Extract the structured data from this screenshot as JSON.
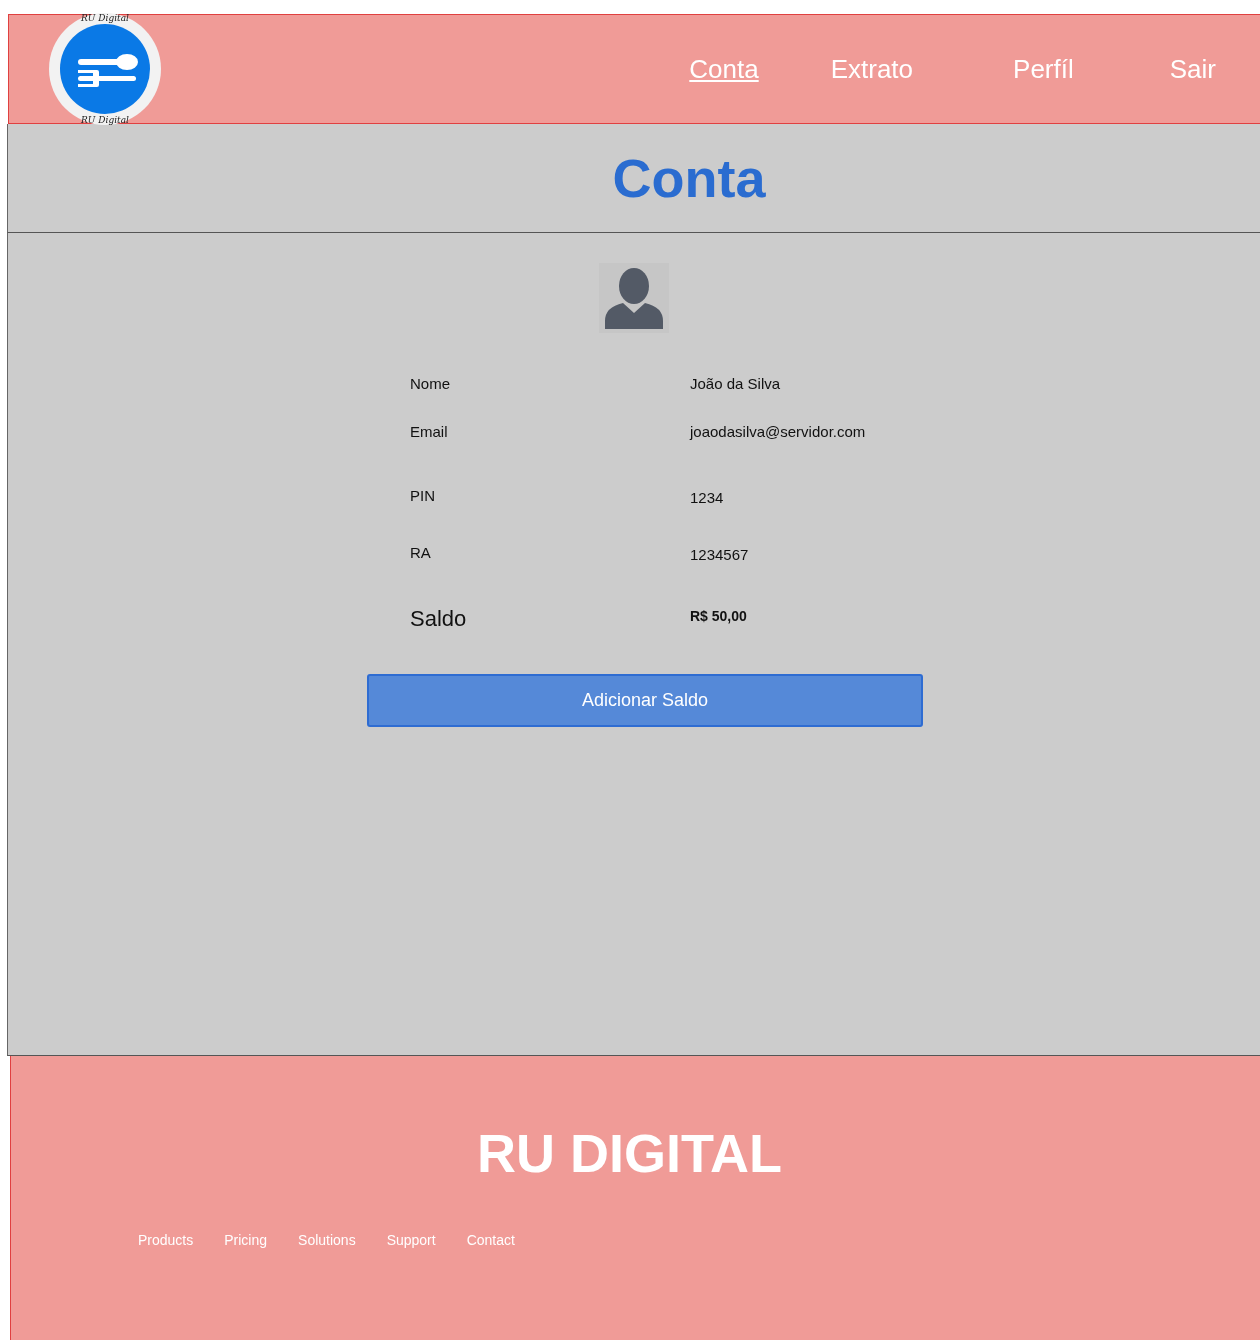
{
  "header": {
    "logo": {
      "top_text": "RU Digital",
      "bottom_text": "RU Digital"
    },
    "nav": [
      {
        "label": "Conta",
        "selected": true
      },
      {
        "label": "Extrato",
        "selected": false
      },
      {
        "label": "Perfíl",
        "selected": false
      },
      {
        "label": "Sair",
        "selected": false
      }
    ]
  },
  "page_title": "Conta",
  "fields": [
    {
      "label": "Nome",
      "value": "João da Silva",
      "kind": "plain"
    },
    {
      "label": "Email",
      "value": "joaodasilva@servidor.com",
      "kind": "plain"
    },
    {
      "label": "PIN",
      "value": "1234",
      "kind": "plain"
    },
    {
      "label": "RA",
      "value": "1234567",
      "kind": "plain"
    },
    {
      "label": "Saldo",
      "value": "R$ 50,00",
      "kind": "total"
    }
  ],
  "button": "Adicionar Saldo",
  "footer": {
    "title": "RU DIGITAL",
    "links": [
      "Products",
      "Pricing",
      "Solutions",
      "Support",
      "Contact"
    ]
  }
}
